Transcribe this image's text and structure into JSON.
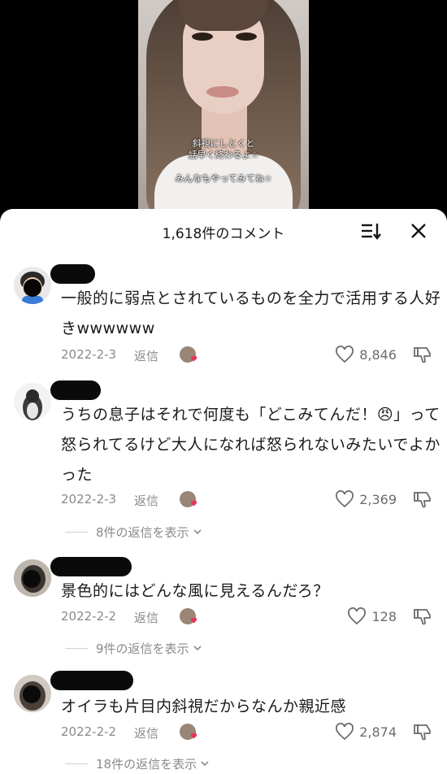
{
  "video": {
    "caption_line1": "斜視にしとくと",
    "caption_line2": "話早く終わるよ☆",
    "caption_line3": "みんなもやってみてね☆"
  },
  "header": {
    "title": "1,618件のコメント",
    "sort_icon": "sort-icon",
    "close_icon": "close-icon"
  },
  "comments": [
    {
      "text": "一般的に弱点とされているものを全力で活用する人好きwwwwww",
      "date": "2022-2-3",
      "reply": "返信",
      "likes": "8,846"
    },
    {
      "text": "うちの息子はそれで何度も「どこみてんだ！😠」って怒られてるけど大人になれば怒られないみたいでよかった",
      "date": "2022-2-3",
      "reply": "返信",
      "likes": "2,369",
      "view_replies": "8件の返信を表示"
    },
    {
      "text": "景色的にはどんな風に見えるんだろ？",
      "date": "2022-2-2",
      "reply": "返信",
      "likes": "128",
      "view_replies": "9件の返信を表示"
    },
    {
      "text": "オイラも片目内斜視だからなんか親近感",
      "date": "2022-2-2",
      "reply": "返信",
      "likes": "2,874",
      "view_replies": "18件の返信を表示"
    }
  ],
  "colors": {
    "heart_red": "#e8345a",
    "text_gray": "#8a8a8a"
  }
}
